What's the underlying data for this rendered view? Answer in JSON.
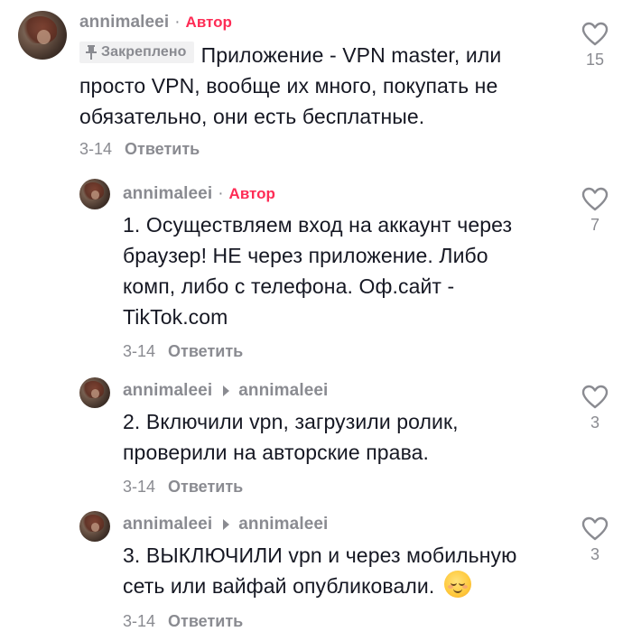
{
  "comments": [
    {
      "username": "annimaleei",
      "separator": "·",
      "author_badge": "Автор",
      "pinned_label": "Закреплено",
      "text_lines": [
        "Приложение - VPN master, или",
        "просто VPN, вообще их много, покупать не",
        "обязательно, они есть бесплатные."
      ],
      "date": "3-14",
      "reply_label": "Ответить",
      "likes": "15"
    },
    {
      "username": "annimaleei",
      "separator": "·",
      "author_badge": "Автор",
      "text_lines": [
        "1. Осуществляем вход на аккаунт через",
        "браузер! НЕ через приложение. Либо",
        "комп, либо с телефона. Оф.сайт -",
        "TikTok.com"
      ],
      "date": "3-14",
      "reply_label": "Ответить",
      "likes": "7"
    },
    {
      "username": "annimaleei",
      "reply_to": "annimaleei",
      "text_lines": [
        "2. Включили vpn, загрузили ролик,",
        "проверили на авторские права."
      ],
      "date": "3-14",
      "reply_label": "Ответить",
      "likes": "3"
    },
    {
      "username": "annimaleei",
      "reply_to": "annimaleei",
      "text_lines": [
        "3. ВЫКЛЮЧИЛИ vpn и через мобильную",
        "сеть или вайфай опубликовали."
      ],
      "emoji": "relieved-face",
      "date": "3-14",
      "reply_label": "Ответить",
      "likes": "3"
    }
  ],
  "colors": {
    "author_badge": "#fe2c55",
    "muted": "#8a8b91",
    "text": "#161823",
    "background": "#ffffff"
  },
  "icons": {
    "like": "heart-outline-icon",
    "pin": "pin-icon",
    "reply_arrow": "caret-right-icon"
  }
}
